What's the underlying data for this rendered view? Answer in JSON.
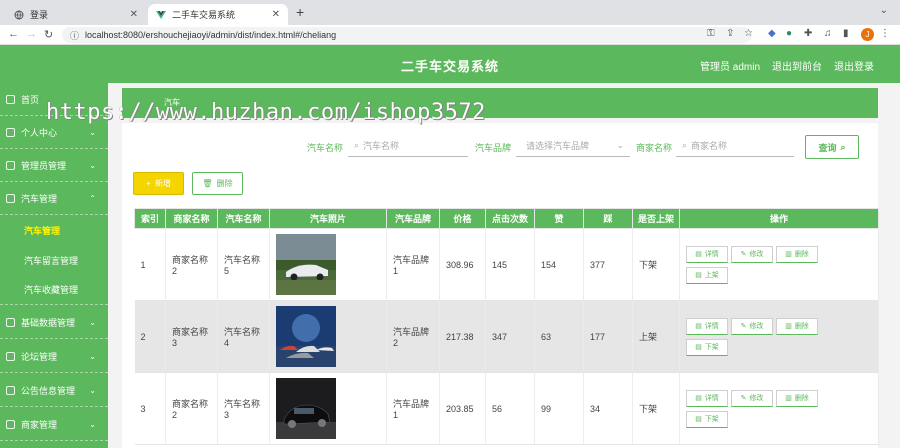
{
  "browser": {
    "tabs": [
      {
        "title": "登录",
        "active": false
      },
      {
        "title": "二手车交易系统",
        "active": true
      }
    ],
    "new_tab": "+",
    "url": "localhost:8080/ershouchejiaoyi/admin/dist/index.html#/cheliang",
    "profile_initial": "J"
  },
  "header": {
    "title": "二手车交易系统",
    "user": "管理员 admin",
    "front": "退出到前台",
    "logout": "退出登录"
  },
  "sidebar": {
    "items": [
      {
        "label": "首页"
      },
      {
        "label": "个人中心"
      },
      {
        "label": "管理员管理"
      },
      {
        "label": "汽车管理"
      },
      {
        "label": "基础数据管理"
      },
      {
        "label": "论坛管理"
      },
      {
        "label": "公告信息管理"
      },
      {
        "label": "商家管理"
      }
    ],
    "sub_items": [
      {
        "label": "汽车管理",
        "active": true
      },
      {
        "label": "汽车留言管理",
        "active": false
      },
      {
        "label": "汽车收藏管理",
        "active": false
      }
    ]
  },
  "breadcrumb": "汽车",
  "watermark": "https://www.huzhan.com/ishop3572",
  "search": {
    "car_name_label": "汽车名称",
    "car_name_placeholder": "汽车名称",
    "brand_label": "汽车品牌",
    "brand_placeholder": "请选择汽车品牌",
    "merchant_label": "商家名称",
    "merchant_placeholder": "商家名称",
    "query": "查询"
  },
  "actions": {
    "add": "新增",
    "delete": "删除"
  },
  "table": {
    "headers": [
      "索引",
      "商家名称",
      "汽车名称",
      "汽车照片",
      "汽车品牌",
      "价格",
      "点击次数",
      "赞",
      "踩",
      "是否上架",
      "操作"
    ],
    "op_labels": {
      "detail": "详情",
      "edit": "修改",
      "delete": "删除"
    },
    "rows": [
      {
        "index": "1",
        "merchant": "商家名称2",
        "car": "汽车名称5",
        "brand": "汽车品牌1",
        "price": "308.96",
        "clicks": "145",
        "likes": "154",
        "dislikes": "377",
        "status": "下架",
        "toggle": "上架"
      },
      {
        "index": "2",
        "merchant": "商家名称3",
        "car": "汽车名称4",
        "brand": "汽车品牌2",
        "price": "217.38",
        "clicks": "347",
        "likes": "63",
        "dislikes": "177",
        "status": "上架",
        "toggle": "下架"
      },
      {
        "index": "3",
        "merchant": "商家名称2",
        "car": "汽车名称3",
        "brand": "汽车品牌1",
        "price": "203.85",
        "clicks": "56",
        "likes": "99",
        "dislikes": "34",
        "status": "下架",
        "toggle": "下架"
      }
    ]
  },
  "colors": {
    "accent": "#5cb85c",
    "add_button": "#f5d500",
    "active_sub": "#fff200"
  }
}
